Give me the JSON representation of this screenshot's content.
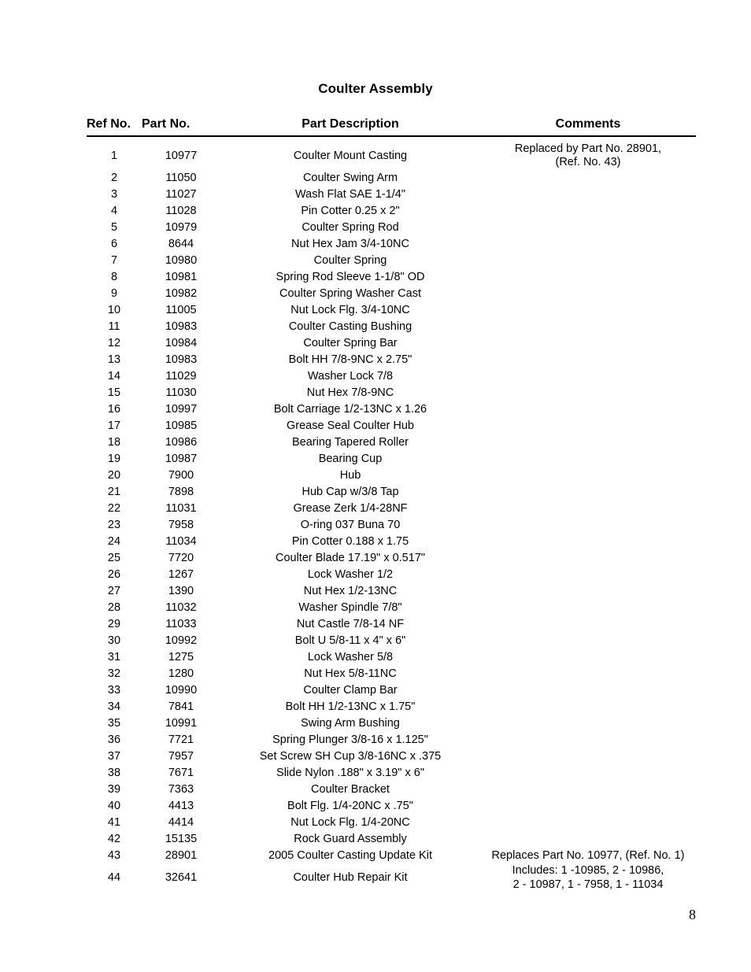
{
  "document": {
    "title": "Coulter Assembly",
    "page_number": "8"
  },
  "table": {
    "headers": {
      "ref_no": "Ref No.",
      "part_no": "Part No.",
      "description": "Part Description",
      "comments": "Comments"
    },
    "rows": [
      {
        "ref": "1",
        "part": "10977",
        "desc": "Coulter Mount Casting",
        "comment_lines": [
          "Replaced by Part No. 28901,",
          "(Ref. No. 43)"
        ]
      },
      {
        "ref": "2",
        "part": "11050",
        "desc": "Coulter Swing Arm",
        "comment_lines": []
      },
      {
        "ref": "3",
        "part": "11027",
        "desc": "Wash Flat SAE 1-1/4\"",
        "comment_lines": []
      },
      {
        "ref": "4",
        "part": "11028",
        "desc": "Pin Cotter 0.25 x 2\"",
        "comment_lines": []
      },
      {
        "ref": "5",
        "part": "10979",
        "desc": "Coulter Spring Rod",
        "comment_lines": []
      },
      {
        "ref": "6",
        "part": "8644",
        "desc": "Nut Hex Jam 3/4-10NC",
        "comment_lines": []
      },
      {
        "ref": "7",
        "part": "10980",
        "desc": "Coulter Spring",
        "comment_lines": []
      },
      {
        "ref": "8",
        "part": "10981",
        "desc": "Spring Rod Sleeve 1-1/8\" OD",
        "comment_lines": []
      },
      {
        "ref": "9",
        "part": "10982",
        "desc": "Coulter Spring Washer Cast",
        "comment_lines": []
      },
      {
        "ref": "10",
        "part": "11005",
        "desc": "Nut Lock Flg. 3/4-10NC",
        "comment_lines": []
      },
      {
        "ref": "11",
        "part": "10983",
        "desc": "Coulter Casting Bushing",
        "comment_lines": []
      },
      {
        "ref": "12",
        "part": "10984",
        "desc": "Coulter Spring Bar",
        "comment_lines": []
      },
      {
        "ref": "13",
        "part": "10983",
        "desc": "Bolt HH 7/8-9NC x 2.75\"",
        "comment_lines": []
      },
      {
        "ref": "14",
        "part": "11029",
        "desc": "Washer Lock 7/8",
        "comment_lines": []
      },
      {
        "ref": "15",
        "part": "11030",
        "desc": "Nut Hex 7/8-9NC",
        "comment_lines": []
      },
      {
        "ref": "16",
        "part": "10997",
        "desc": "Bolt Carriage 1/2-13NC x 1.26",
        "comment_lines": []
      },
      {
        "ref": "17",
        "part": "10985",
        "desc": "Grease Seal Coulter Hub",
        "comment_lines": []
      },
      {
        "ref": "18",
        "part": "10986",
        "desc": "Bearing Tapered Roller",
        "comment_lines": []
      },
      {
        "ref": "19",
        "part": "10987",
        "desc": "Bearing Cup",
        "comment_lines": []
      },
      {
        "ref": "20",
        "part": "7900",
        "desc": "Hub",
        "comment_lines": []
      },
      {
        "ref": "21",
        "part": "7898",
        "desc": "Hub Cap w/3/8 Tap",
        "comment_lines": []
      },
      {
        "ref": "22",
        "part": "11031",
        "desc": "Grease Zerk 1/4-28NF",
        "comment_lines": []
      },
      {
        "ref": "23",
        "part": "7958",
        "desc": "O-ring 037 Buna 70",
        "comment_lines": []
      },
      {
        "ref": "24",
        "part": "11034",
        "desc": "Pin Cotter 0.188 x 1.75",
        "comment_lines": []
      },
      {
        "ref": "25",
        "part": "7720",
        "desc": "Coulter Blade 17.19\" x 0.517\"",
        "comment_lines": []
      },
      {
        "ref": "26",
        "part": "1267",
        "desc": "Lock Washer 1/2",
        "comment_lines": []
      },
      {
        "ref": "27",
        "part": "1390",
        "desc": "Nut Hex 1/2-13NC",
        "comment_lines": []
      },
      {
        "ref": "28",
        "part": "11032",
        "desc": "Washer Spindle 7/8\"",
        "comment_lines": []
      },
      {
        "ref": "29",
        "part": "11033",
        "desc": "Nut Castle 7/8-14 NF",
        "comment_lines": []
      },
      {
        "ref": "30",
        "part": "10992",
        "desc": "Bolt U 5/8-11 x 4\" x 6\"",
        "comment_lines": []
      },
      {
        "ref": "31",
        "part": "1275",
        "desc": "Lock Washer 5/8",
        "comment_lines": []
      },
      {
        "ref": "32",
        "part": "1280",
        "desc": "Nut Hex 5/8-11NC",
        "comment_lines": []
      },
      {
        "ref": "33",
        "part": "10990",
        "desc": "Coulter Clamp Bar",
        "comment_lines": []
      },
      {
        "ref": "34",
        "part": "7841",
        "desc": "Bolt HH 1/2-13NC x 1.75\"",
        "comment_lines": []
      },
      {
        "ref": "35",
        "part": "10991",
        "desc": "Swing Arm Bushing",
        "comment_lines": []
      },
      {
        "ref": "36",
        "part": "7721",
        "desc": "Spring Plunger 3/8-16 x 1.125\"",
        "comment_lines": []
      },
      {
        "ref": "37",
        "part": "7957",
        "desc": "Set Screw SH Cup 3/8-16NC x .375",
        "comment_lines": []
      },
      {
        "ref": "38",
        "part": "7671",
        "desc": "Slide Nylon .188\" x 3.19\" x 6\"",
        "comment_lines": []
      },
      {
        "ref": "39",
        "part": "7363",
        "desc": "Coulter Bracket",
        "comment_lines": []
      },
      {
        "ref": "40",
        "part": "4413",
        "desc": "Bolt Flg. 1/4-20NC x .75\"",
        "comment_lines": []
      },
      {
        "ref": "41",
        "part": "4414",
        "desc": "Nut Lock Flg. 1/4-20NC",
        "comment_lines": []
      },
      {
        "ref": "42",
        "part": "15135",
        "desc": "Rock Guard Assembly",
        "comment_lines": []
      },
      {
        "ref": "43",
        "part": "28901",
        "desc": "2005 Coulter Casting Update Kit",
        "comment_lines": [
          "Replaces Part No. 10977, (Ref. No. 1)"
        ]
      },
      {
        "ref": "44",
        "part": "32641",
        "desc": "Coulter Hub Repair Kit",
        "comment_lines": [
          "Includes: 1 -10985, 2 - 10986,",
          "2 - 10987, 1 - 7958, 1 - 11034"
        ]
      }
    ]
  }
}
